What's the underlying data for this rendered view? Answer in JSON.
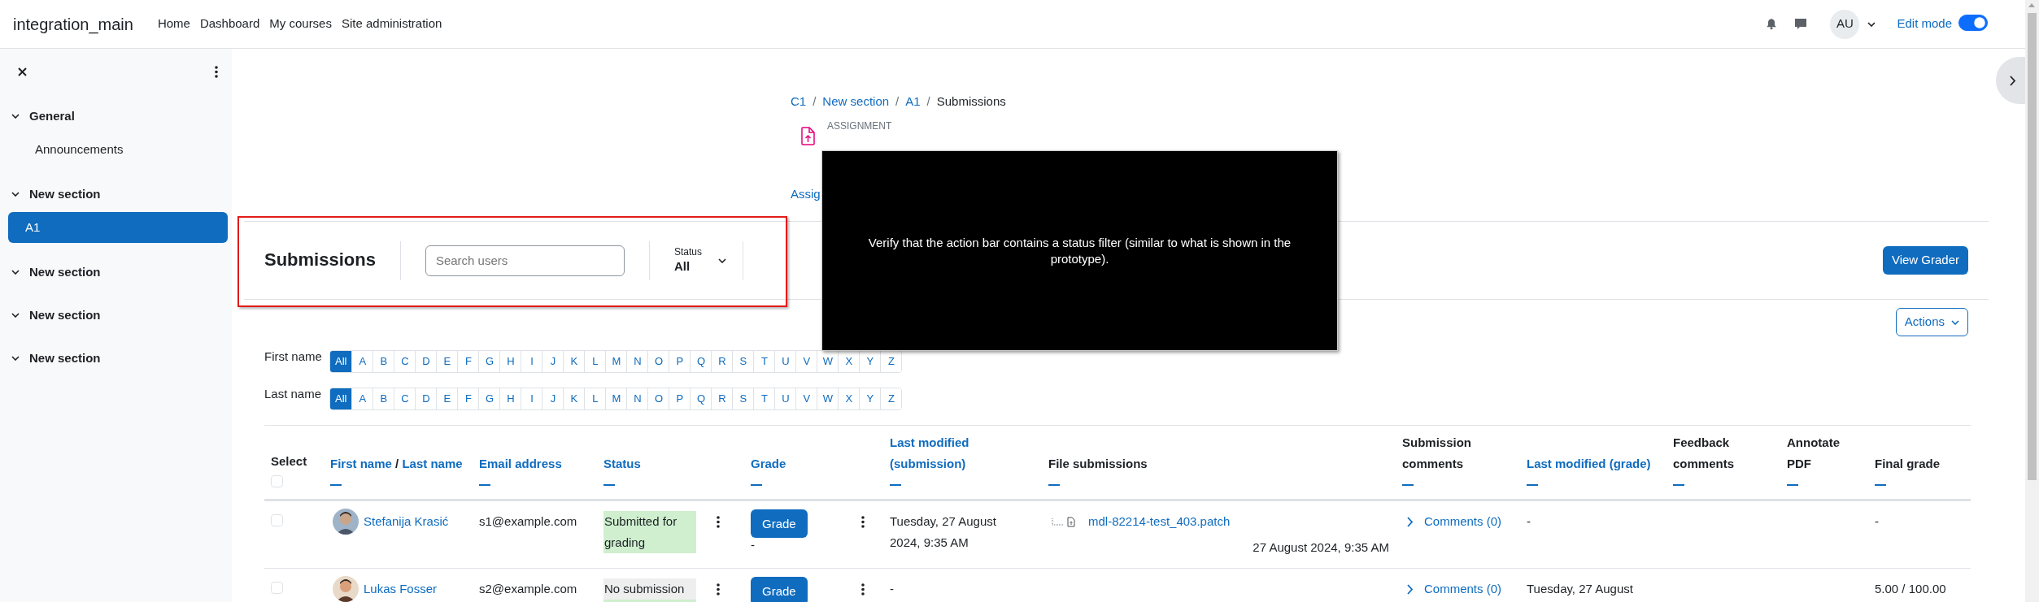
{
  "navbar": {
    "brand": "integration_main",
    "links": [
      "Home",
      "Dashboard",
      "My courses",
      "Site administration"
    ],
    "user_initials": "AU",
    "edit_mode": {
      "label": "Edit mode",
      "on": true
    }
  },
  "course_index": {
    "sections": [
      {
        "title": "General",
        "expanded": true,
        "items": [
          {
            "label": "Announcements",
            "selected": false
          }
        ]
      },
      {
        "title": "New section",
        "expanded": true,
        "items": [
          {
            "label": "A1",
            "selected": true
          }
        ]
      },
      {
        "title": "New section",
        "expanded": true
      },
      {
        "title": "New section",
        "expanded": true
      },
      {
        "title": "New section",
        "expanded": true
      }
    ]
  },
  "breadcrumb": [
    {
      "text": "C1",
      "kind": "link"
    },
    {
      "text": "/",
      "kind": "separator"
    },
    {
      "text": "New section",
      "kind": "link"
    },
    {
      "text": "/",
      "kind": "separator"
    },
    {
      "text": "A1",
      "kind": "link"
    },
    {
      "text": "/",
      "kind": "separator"
    },
    {
      "text": "Submissions",
      "kind": "current"
    }
  ],
  "activity": {
    "type_label": "ASSIGNMENT",
    "tab": "Assig"
  },
  "action_bar": {
    "highlighted": true,
    "heading": "Submissions",
    "search": {
      "placeholder": "Search users"
    },
    "status_filter": {
      "label": "Status",
      "value": "All"
    },
    "primary_button": "View Grader"
  },
  "actions_button": "Actions",
  "initials_bars": [
    {
      "label": "First name",
      "letters": [
        {
          "label": "All",
          "selected": true
        },
        {
          "label": "A",
          "selected": false
        },
        {
          "label": "B",
          "selected": false
        },
        {
          "label": "C",
          "selected": false
        },
        {
          "label": "D",
          "selected": false
        },
        {
          "label": "E",
          "selected": false
        },
        {
          "label": "F",
          "selected": false
        },
        {
          "label": "G",
          "selected": false
        },
        {
          "label": "H",
          "selected": false
        },
        {
          "label": "I",
          "selected": false
        },
        {
          "label": "J",
          "selected": false
        },
        {
          "label": "K",
          "selected": false
        },
        {
          "label": "L",
          "selected": false
        },
        {
          "label": "M",
          "selected": false
        },
        {
          "label": "N",
          "selected": false
        },
        {
          "label": "O",
          "selected": false
        },
        {
          "label": "P",
          "selected": false
        },
        {
          "label": "Q",
          "selected": false
        },
        {
          "label": "R",
          "selected": false
        },
        {
          "label": "S",
          "selected": false
        },
        {
          "label": "T",
          "selected": false
        },
        {
          "label": "U",
          "selected": false
        },
        {
          "label": "V",
          "selected": false
        },
        {
          "label": "W",
          "selected": false
        },
        {
          "label": "X",
          "selected": false
        },
        {
          "label": "Y",
          "selected": false
        },
        {
          "label": "Z",
          "selected": false
        }
      ]
    },
    {
      "label": "Last name",
      "letters": [
        {
          "label": "All",
          "selected": true
        },
        {
          "label": "A",
          "selected": false
        },
        {
          "label": "B",
          "selected": false
        },
        {
          "label": "C",
          "selected": false
        },
        {
          "label": "D",
          "selected": false
        },
        {
          "label": "E",
          "selected": false
        },
        {
          "label": "F",
          "selected": false
        },
        {
          "label": "G",
          "selected": false
        },
        {
          "label": "H",
          "selected": false
        },
        {
          "label": "I",
          "selected": false
        },
        {
          "label": "J",
          "selected": false
        },
        {
          "label": "K",
          "selected": false
        },
        {
          "label": "L",
          "selected": false
        },
        {
          "label": "M",
          "selected": false
        },
        {
          "label": "N",
          "selected": false
        },
        {
          "label": "O",
          "selected": false
        },
        {
          "label": "P",
          "selected": false
        },
        {
          "label": "Q",
          "selected": false
        },
        {
          "label": "R",
          "selected": false
        },
        {
          "label": "S",
          "selected": false
        },
        {
          "label": "T",
          "selected": false
        },
        {
          "label": "U",
          "selected": false
        },
        {
          "label": "V",
          "selected": false
        },
        {
          "label": "W",
          "selected": false
        },
        {
          "label": "X",
          "selected": false
        },
        {
          "label": "Y",
          "selected": false
        },
        {
          "label": "Z",
          "selected": false
        }
      ]
    }
  ],
  "table": {
    "columns": [
      {
        "kind": "select",
        "label": "Select",
        "checked": false
      },
      {
        "kind": "name",
        "parts": [
          {
            "text": "First name",
            "kind": "link"
          },
          {
            "text": "/",
            "kind": "separator"
          },
          {
            "text": "Last name",
            "kind": "link"
          }
        ]
      },
      {
        "kind": "sortable",
        "label": "Email address"
      },
      {
        "kind": "sortable",
        "label": "Status",
        "has_menu": true
      },
      {
        "kind": "sortable",
        "label": "Grade",
        "has_menu": true
      },
      {
        "kind": "sortable",
        "label": "Last modified (submission)"
      },
      {
        "kind": "plain",
        "label": "File submissions"
      },
      {
        "kind": "plain",
        "label": "Submission comments"
      },
      {
        "kind": "sortable",
        "label": "Last modified (grade)"
      },
      {
        "kind": "plain",
        "label": "Feedback comments"
      },
      {
        "kind": "plain",
        "label": "Annotate PDF"
      },
      {
        "kind": "plain",
        "label": "Final grade"
      }
    ],
    "rows": [
      {
        "checked": false,
        "name": "Stefanija Krasić",
        "email": "s1@example.com",
        "status": [
          {
            "text": "Submitted for grading",
            "color": "#cfefcf"
          }
        ],
        "grade_button": "Grade",
        "grade": "-",
        "last_modified": "Tuesday, 27 August 2024, 9:35 AM",
        "file": {
          "name": "mdl-82214-test_403.patch",
          "date": "27 August 2024, 9:35 AM"
        },
        "comments": "Comments (0)",
        "last_modified_grade": "-",
        "final_grade": "-"
      },
      {
        "checked": false,
        "name": "Lukas Fosser",
        "email": "s2@example.com",
        "status": [
          {
            "text": "No submission",
            "color": "#eeeeee"
          },
          {
            "color": "#cfefcf"
          }
        ],
        "grade_button": "Grade",
        "last_modified": "-",
        "comments": "Comments (0)",
        "last_modified_grade": "Tuesday, 27 August",
        "final_grade": "5.00 / 100.00"
      }
    ]
  },
  "annotation": {
    "text": "Verify that the action bar contains a status filter (similar to what is shown in the prototype)."
  }
}
